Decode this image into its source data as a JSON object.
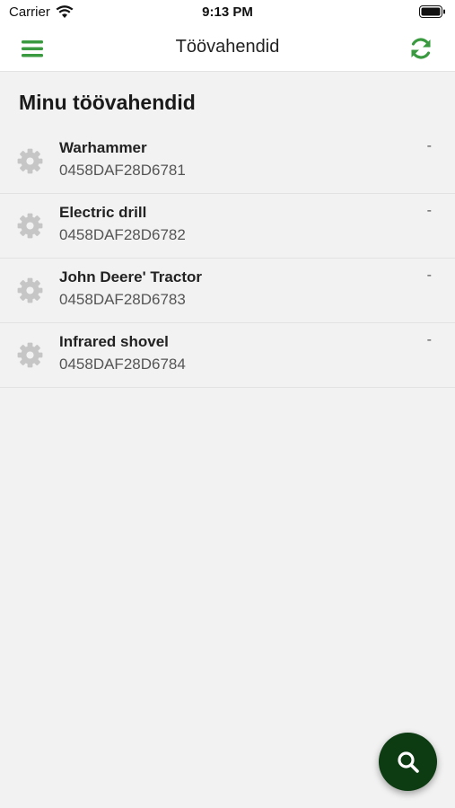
{
  "status_bar": {
    "carrier": "Carrier",
    "time": "9:13 PM",
    "wifi_icon": "wifi-icon",
    "battery_icon": "battery-icon"
  },
  "nav": {
    "title": "Töövahendid",
    "menu_icon": "hamburger-menu-icon",
    "refresh_icon": "refresh-icon"
  },
  "section": {
    "title": "Minu töövahendid"
  },
  "tools": [
    {
      "name": "Warhammer",
      "code": "0458DAF28D6781",
      "status": "-",
      "icon": "gear-icon"
    },
    {
      "name": "Electric drill",
      "code": "0458DAF28D6782",
      "status": "-",
      "icon": "gear-icon"
    },
    {
      "name": "John Deere' Tractor",
      "code": "0458DAF28D6783",
      "status": "-",
      "icon": "gear-icon"
    },
    {
      "name": "Infrared shovel",
      "code": "0458DAF28D6784",
      "status": "-",
      "icon": "gear-icon"
    }
  ],
  "fab": {
    "icon": "search-icon"
  },
  "colors": {
    "accent_green": "#3a9a3f",
    "fab_background": "#0d3b12",
    "background": "#f2f2f2",
    "bar_background": "#ffffff",
    "gear_gray": "#c6c6c6"
  }
}
